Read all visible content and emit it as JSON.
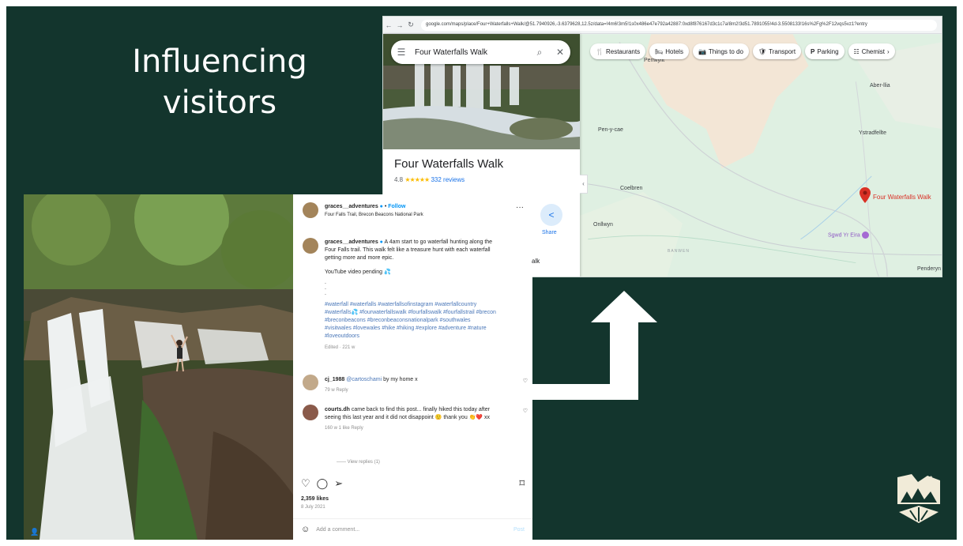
{
  "slide": {
    "title_line1": "Influencing",
    "title_line2": "visitors"
  },
  "maps": {
    "url": "google.com/maps/place/Four+Waterfalls+Walk/@51.7940926,-3.6379628,12.5z/data=!4m6!3m5!1s0x486e47e792a42887:0xd8f876167d3c1c7a!8m2!3d51.7891055!4d-3.5508133!16s%2Fg%2F12vqs5vz1?entry",
    "search_value": "Four Waterfalls Walk",
    "place_name": "Four Waterfalls Walk",
    "rating": "4.8",
    "stars": "★★★★★",
    "reviews": "332 reviews",
    "share_label": "Share",
    "walk_fragment": "alk",
    "chips": [
      {
        "icon": "🍴",
        "label": "Restaurants"
      },
      {
        "icon": "🛏",
        "label": "Hotels"
      },
      {
        "icon": "📷",
        "label": "Things to do"
      },
      {
        "icon": "🛡",
        "label": "Transport"
      },
      {
        "icon": "P",
        "label": "Parking"
      },
      {
        "icon": "☷",
        "label": "Chemist"
      }
    ],
    "labels": {
      "penwyllt": "Penwyllt",
      "aber_llia": "Aber-llia",
      "pen_y_cae": "Pen-y-cae",
      "ystradfellte": "Ystradfellte",
      "coelbren": "Coelbren",
      "onllwyn": "Onllwyn",
      "penderyn": "Penderyn",
      "banwen": "BANWEN",
      "pin_label": "Four Waterfalls Walk",
      "poi": "Sgwd Yr Eira"
    },
    "colors": {
      "map_green": "#dff0e2",
      "moor": "#f3e6d6",
      "pin": "#d93025"
    }
  },
  "instagram": {
    "username": "graces__adventures",
    "follow": "Follow",
    "location": "Four Falls Trail, Brecon Beacons National Park",
    "caption_user": "graces__adventures",
    "caption_text": "A 4am start to go waterfall hunting along the Four Falls trail. This walk felt like a treasure hunt with each waterfall getting more and more epic.",
    "youtube": "YouTube video pending 💦",
    "dots": ".\n.\n.",
    "hashtags": "#waterfall #waterfalls #waterfallsofinstagram #waterfallcountry #waterfalls💦 #fourwaterfallswalk #fourfallswalk #fourfallstrail #brecon #breconbeacons #breconbeaconsnationalpark #southwales #visitwales #lovewales #hike #hiking #explore #adventure #nature #loveoutdoors",
    "caption_meta": "Edited · 221 w",
    "comment1_user": "cj_1988",
    "comment1_mention": "@cartoschami",
    "comment1_text": "by my home x",
    "comment1_meta": "79 w   Reply",
    "comment2_user": "courts.dh",
    "comment2_text": "came back to find this post... finally hiked this today after seeing this last year and it did not disappoint 🙂 thank you 👏❤️ xx",
    "comment2_meta": "160 w   1 like   Reply",
    "view_replies": "View replies (1)",
    "likes": "2,359 likes",
    "date": "8 July 2021",
    "add_comment": "Add a comment...",
    "post": "Post"
  }
}
